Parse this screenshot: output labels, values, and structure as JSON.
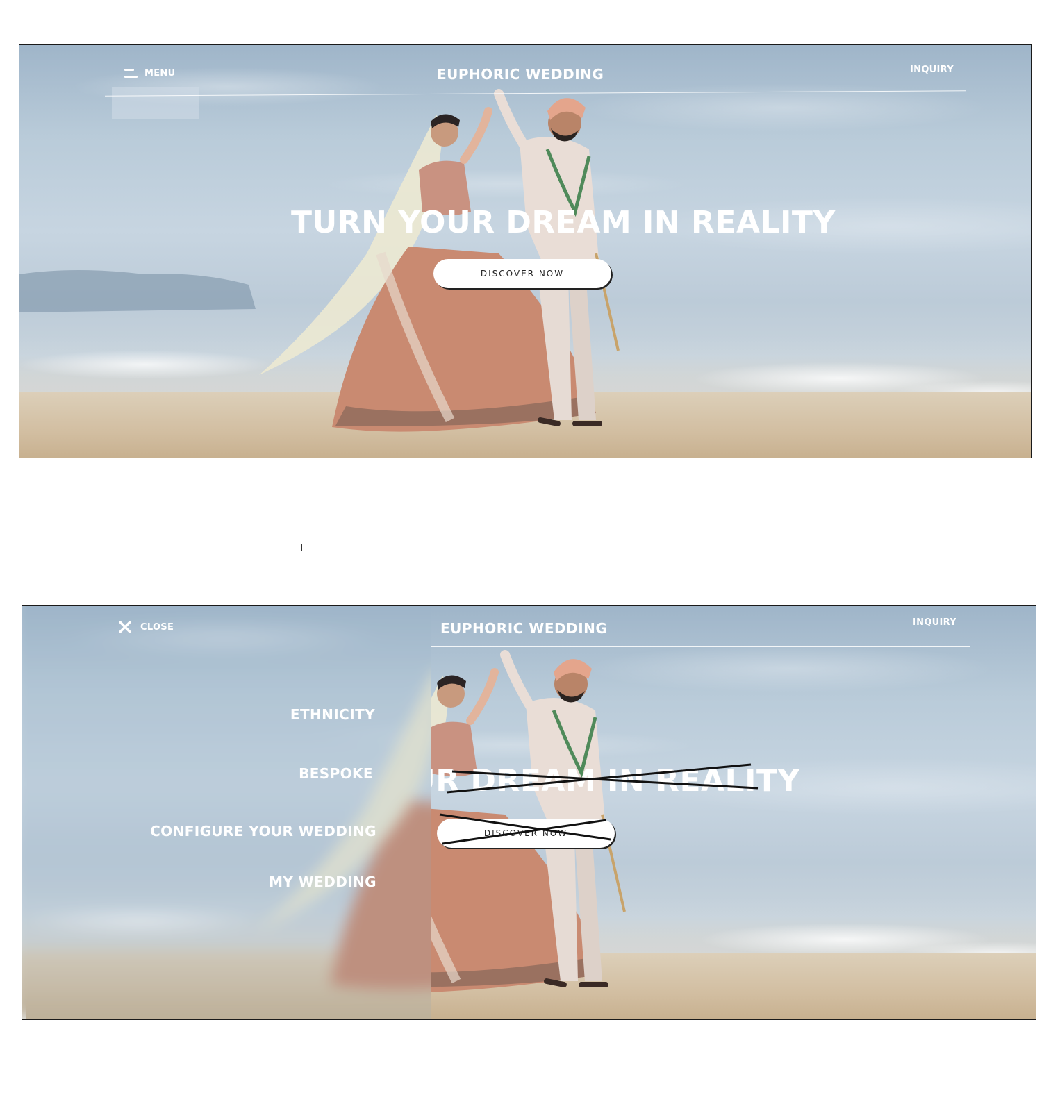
{
  "header": {
    "menu_label": "MENU",
    "brand": "EUPHORIC WEDDING",
    "inquiry_label": "INQUIRY"
  },
  "hero": {
    "title": "TURN YOUR DREAM IN REALITY",
    "title_partial": "UR DREAM IN REALITY",
    "cta_label": "DISCOVER NOW"
  },
  "menu_overlay": {
    "close_label": "CLOSE",
    "items": [
      {
        "label": "ETHNICITY"
      },
      {
        "label": "BESPOKE"
      },
      {
        "label": "CONFIGURE YOUR WEDDING"
      },
      {
        "label": "MY WEDDING"
      }
    ]
  },
  "colors": {
    "text": "#ffffff",
    "button_bg": "#ffffff",
    "button_text": "#222222",
    "sky": "#b9cbd9",
    "sand": "#d2bea1"
  },
  "icons": {
    "menu": "hamburger-icon",
    "close": "close-icon"
  }
}
